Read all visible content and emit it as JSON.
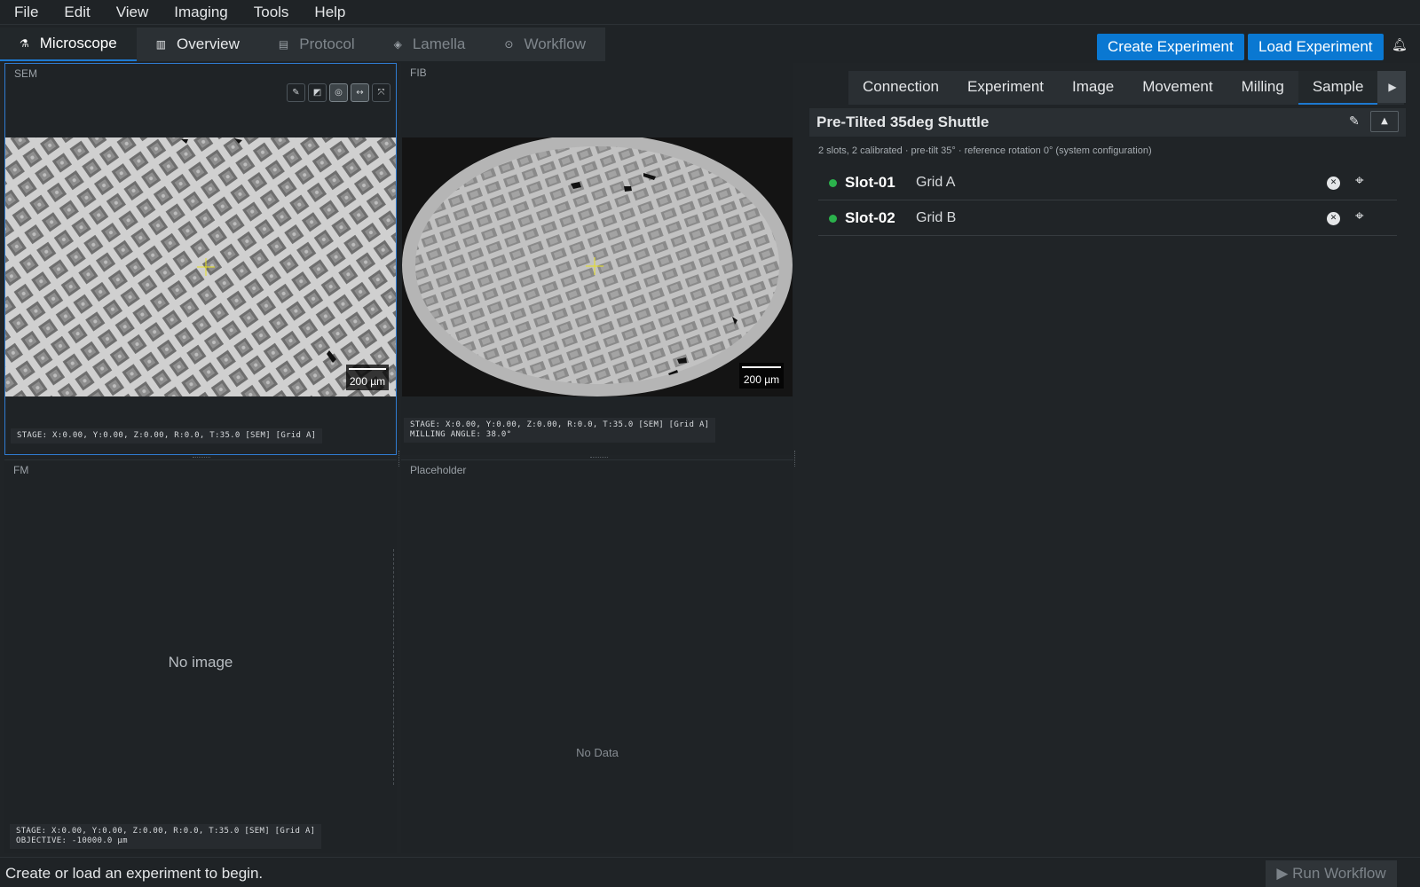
{
  "menu": [
    "File",
    "Edit",
    "View",
    "Imaging",
    "Tools",
    "Help"
  ],
  "main_tabs": [
    {
      "label": "Microscope",
      "icon": "microscope-icon"
    },
    {
      "label": "Overview",
      "icon": "map-icon"
    },
    {
      "label": "Protocol",
      "icon": "document-icon"
    },
    {
      "label": "Lamella",
      "icon": "layers-icon"
    },
    {
      "label": "Workflow",
      "icon": "play-circle-icon"
    }
  ],
  "header_buttons": {
    "create": "Create Experiment",
    "load": "Load Experiment"
  },
  "sem": {
    "label": "SEM",
    "scale": "200 µm",
    "stage": "STAGE: X:0.00, Y:0.00, Z:0.00, R:0.0, T:35.0 [SEM] [Grid A]",
    "tools": [
      "pencil-icon",
      "contrast-icon",
      "target-circle-icon",
      "measure-icon",
      "fit-icon"
    ]
  },
  "fib": {
    "label": "FIB",
    "scale": "200 µm",
    "stage": "STAGE: X:0.00, Y:0.00, Z:0.00, R:0.0, T:35.0 [SEM] [Grid A]",
    "milling": "MILLING ANGLE: 38.0°"
  },
  "fm": {
    "label": "FM",
    "empty": "No image",
    "stage": "STAGE: X:0.00, Y:0.00, Z:0.00, R:0.0, T:35.0 [SEM] [Grid A]",
    "objective": "OBJECTIVE: -10000.0 µm"
  },
  "placeholder": {
    "label": "Placeholder",
    "empty": "No Data"
  },
  "right_tabs": [
    "Connection",
    "Experiment",
    "Image",
    "Movement",
    "Milling",
    "Sample"
  ],
  "sample": {
    "title": "Pre-Tilted 35deg Shuttle",
    "summary": "2 slots, 2 calibrated · pre-tilt 35° · reference rotation 0°   (system configuration)",
    "slots": [
      {
        "name": "Slot-01",
        "grid": "Grid A",
        "status_color": "#2bb24c"
      },
      {
        "name": "Slot-02",
        "grid": "Grid B",
        "status_color": "#2bb24c"
      }
    ]
  },
  "status": {
    "message": "Create or load an experiment to begin.",
    "run": "Run Workflow"
  },
  "colors": {
    "accent": "#0a78d2",
    "ok": "#2bb24c",
    "crosshair": "#e8e020"
  }
}
